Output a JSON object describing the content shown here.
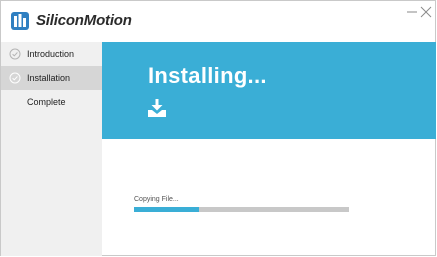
{
  "brand": {
    "name": "SiliconMotion"
  },
  "window_controls": {
    "minimize": "—",
    "close": "✕"
  },
  "steps": [
    {
      "label": "Introduction",
      "icon": "check-circle-icon",
      "state": "done"
    },
    {
      "label": "Installation",
      "icon": "check-circle-icon",
      "state": "current"
    },
    {
      "label": "Complete",
      "icon": null,
      "state": "pending"
    }
  ],
  "banner": {
    "title": "Installing...",
    "icon": "download-tray-icon",
    "color": "#3aaed6"
  },
  "progress": {
    "status": "Copying File...",
    "fraction": 0.3
  }
}
